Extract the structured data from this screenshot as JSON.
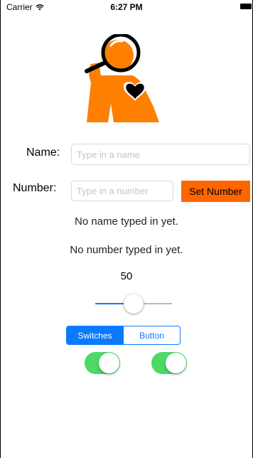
{
  "status_bar": {
    "carrier": "Carrier",
    "wifi_icon": "wifi-icon",
    "time": "6:27 PM",
    "battery_icon": "battery-icon"
  },
  "logo": {
    "icon": "person-magnifier-heart-icon"
  },
  "form": {
    "name_label": "Name:",
    "name_placeholder": "Type in a name",
    "name_value": "",
    "number_label": "Number:",
    "number_placeholder": "Type in a number",
    "number_value": "",
    "set_number_button": "Set Number"
  },
  "status": {
    "name_text": "No name typed in yet.",
    "number_text": "No number typed in yet."
  },
  "slider": {
    "value_label": "50",
    "value": 50,
    "min": 0,
    "max": 100
  },
  "segmented": {
    "segments": [
      "Switches",
      "Button"
    ],
    "selected_index": 0
  },
  "switches": [
    {
      "on": true
    },
    {
      "on": true
    }
  ],
  "colors": {
    "accent": "#0a7aff",
    "button": "#ff6600",
    "switch_on": "#4cd964",
    "logo": "#ff7f00"
  }
}
